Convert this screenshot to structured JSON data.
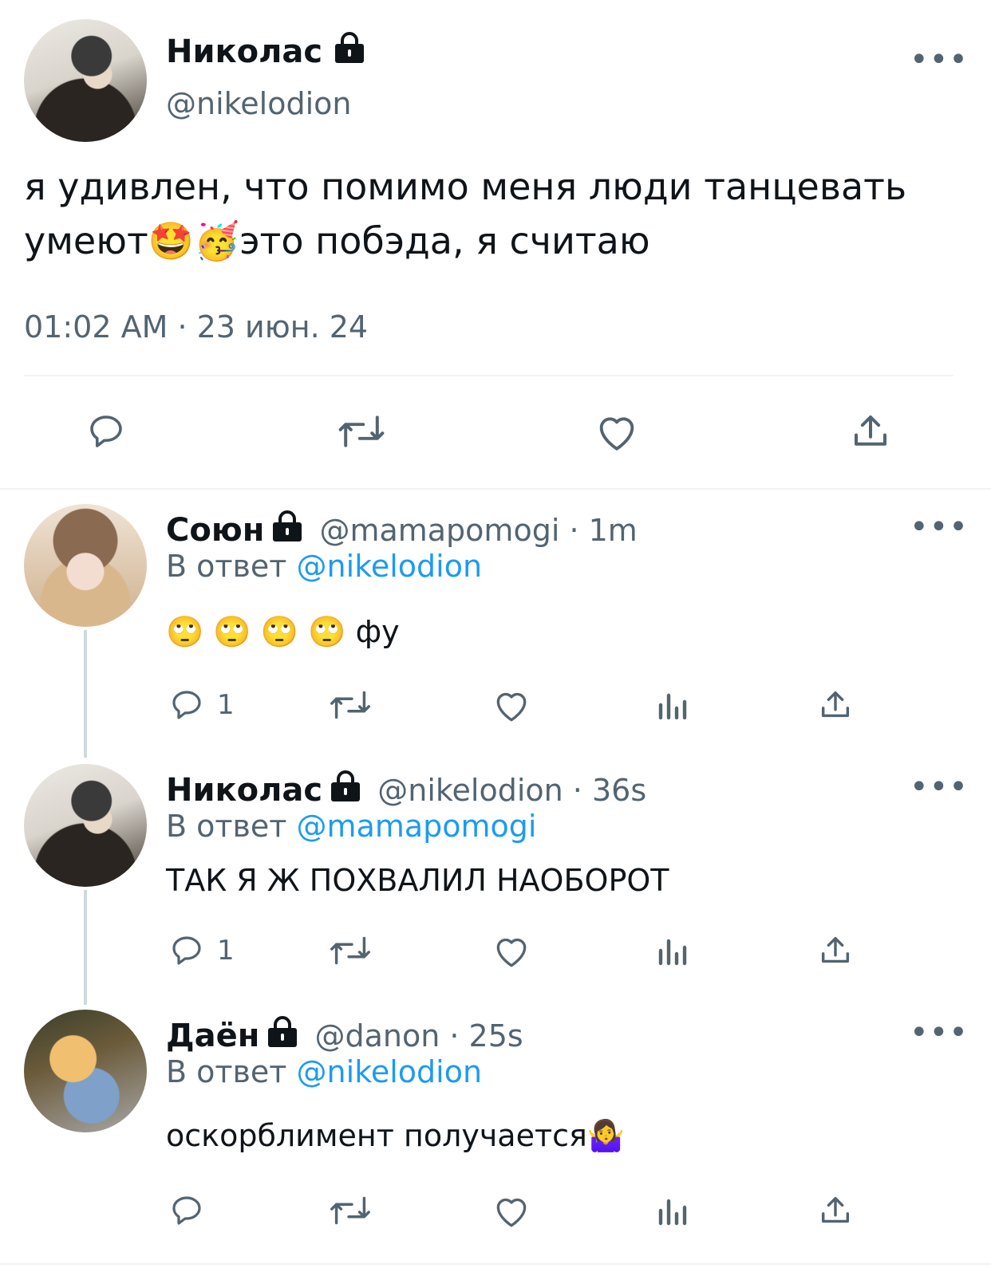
{
  "main_tweet": {
    "name": "Николас",
    "handle": "@nikelodion",
    "text_line1": "я удивлен, что помимо меня люди танцевать",
    "text_line2_a": "умеют",
    "emoji1": "🤩",
    "emoji2": "🥳",
    "text_line2_b": "это побэда, я считаю",
    "timestamp": "01:02 AM · 23 июн. 24"
  },
  "replies": [
    {
      "name": "Союн",
      "handle_time": "@mamapomogi · 1m",
      "reply_prefix": "В ответ",
      "reply_to": "@nikelodion",
      "text": "🙄 🙄 🙄 🙄  фу",
      "reply_count": "1"
    },
    {
      "name": "Николас",
      "handle_time": "@nikelodion · 36s",
      "reply_prefix": "В ответ",
      "reply_to": "@mamapomogi",
      "text": "ТАК Я Ж ПОХВАЛИЛ НАОБОРОТ",
      "reply_count": "1"
    },
    {
      "name": "Даён",
      "handle_time": "@danon · 25s",
      "reply_prefix": "В ответ",
      "reply_to": "@nikelodion",
      "text": "оскорблимент получается🤷‍♀️",
      "reply_count": ""
    }
  ],
  "icons": {
    "lock": "lock-icon",
    "more": "more-icon",
    "reply": "reply-icon",
    "retweet": "retweet-icon",
    "like": "like-icon",
    "views": "views-icon",
    "share": "share-icon"
  },
  "colors": {
    "text": "#0f1419",
    "secondary": "#536471",
    "link": "#1d9bf0",
    "divider": "#eff3f4"
  }
}
